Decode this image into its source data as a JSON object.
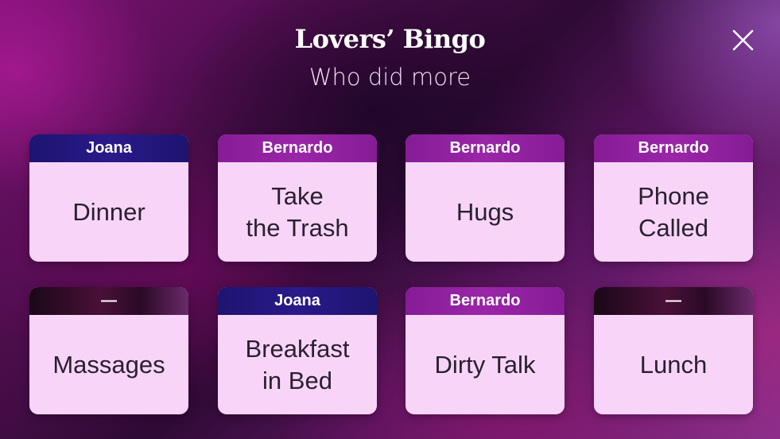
{
  "header": {
    "title": "Lovers’ Bingo",
    "subtitle": "Who did more"
  },
  "close_button": {
    "icon": "close-icon"
  },
  "cards": [
    {
      "owner": "Joana",
      "task": "Dinner",
      "owner_color": "#221780"
    },
    {
      "owner": "Bernardo",
      "task": "Take\nthe Trash",
      "owner_color": "#8f21a0"
    },
    {
      "owner": "Bernardo",
      "task": "Hugs",
      "owner_color": "#8f21a0"
    },
    {
      "owner": "Bernardo",
      "task": "Phone\nCalled",
      "owner_color": "#8f21a0"
    },
    {
      "owner": "—",
      "task": "Massages",
      "owner_color": "#2a0a26"
    },
    {
      "owner": "Joana",
      "task": "Breakfast\nin Bed",
      "owner_color": "#221780"
    },
    {
      "owner": "Bernardo",
      "task": "Dirty Talk",
      "owner_color": "#8f21a0"
    },
    {
      "owner": "—",
      "task": "Lunch",
      "owner_color": "#2a0a26"
    }
  ]
}
